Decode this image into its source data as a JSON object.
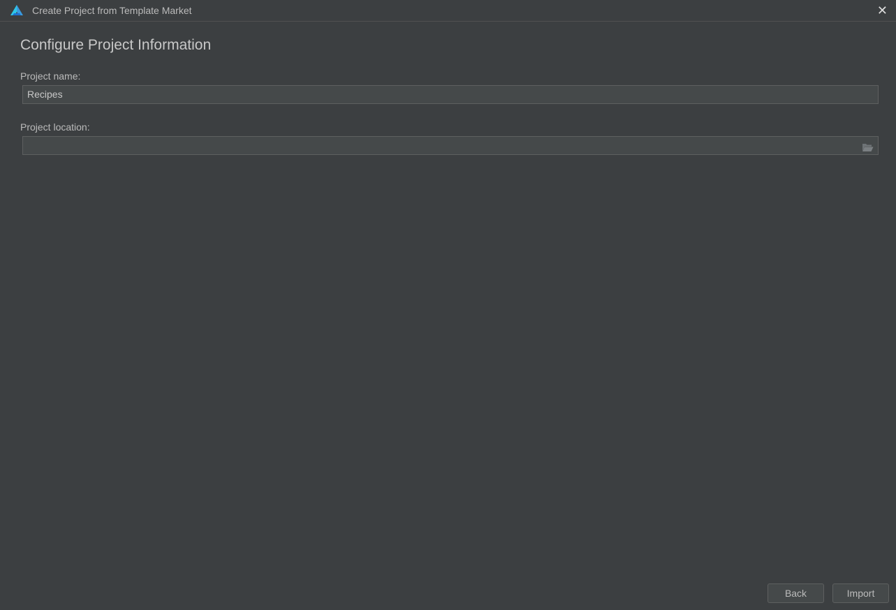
{
  "window": {
    "title": "Create Project from Template Market",
    "close_icon": "close-icon",
    "logo_icon": "app-logo-icon"
  },
  "form": {
    "heading": "Configure Project Information",
    "project_name_label": "Project name:",
    "project_name_value": "Recipes",
    "project_location_label": "Project location:",
    "project_location_value": "",
    "browse_icon": "folder-open-icon"
  },
  "buttons": {
    "back": "Back",
    "import": "Import"
  }
}
